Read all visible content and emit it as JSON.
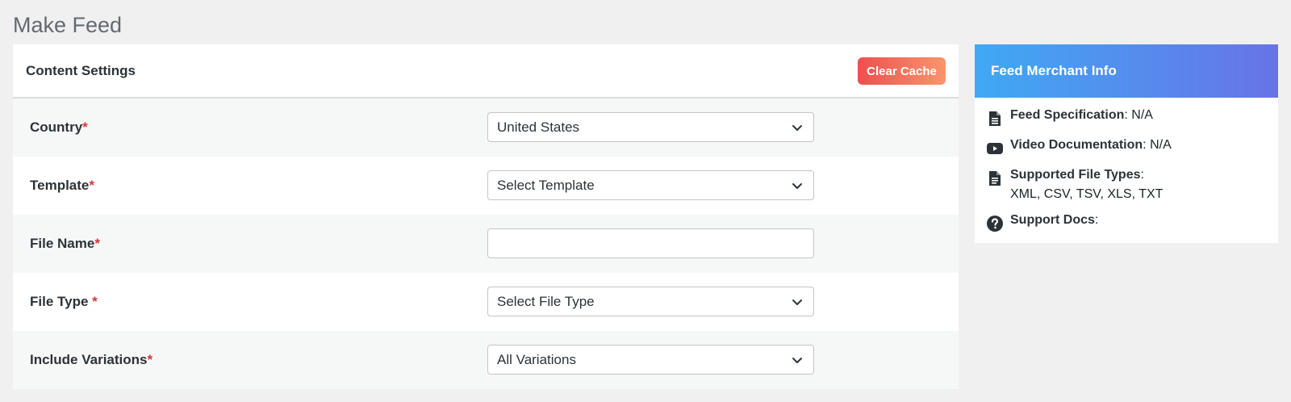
{
  "page": {
    "title": "Make Feed"
  },
  "content": {
    "title": "Content Settings",
    "clear_cache_label": "Clear Cache",
    "fields": [
      {
        "label": "Country",
        "required_mark": "*",
        "value": "United States"
      },
      {
        "label": "Template",
        "required_mark": "*",
        "value": "Select Template"
      },
      {
        "label": "File Name",
        "required_mark": "*",
        "value": ""
      },
      {
        "label": "File Type ",
        "required_mark": "*",
        "value": "Select File Type"
      },
      {
        "label": "Include Variations",
        "required_mark": "*",
        "value": "All Variations"
      }
    ]
  },
  "merchant_info": {
    "title": "Feed Merchant Info",
    "items": [
      {
        "icon": "document-icon",
        "label": "Feed Specification",
        "sep": ": ",
        "value": "N/A"
      },
      {
        "icon": "youtube-icon",
        "label": "Video Documentation",
        "sep": ": ",
        "value": "N/A"
      },
      {
        "icon": "file-icon",
        "label": "Supported File Types",
        "sep": ":",
        "value": "XML, CSV, TSV, XLS, TXT"
      },
      {
        "icon": "question-icon",
        "label": "Support Docs",
        "sep": ":",
        "value": ""
      }
    ]
  },
  "colors": {
    "accent_clear_cache_start": "#ef4f50",
    "accent_clear_cache_end": "#f9956c",
    "merchant_header_start": "#3fa9f5",
    "merchant_header_end": "#6873e6",
    "required": "#d63638"
  }
}
